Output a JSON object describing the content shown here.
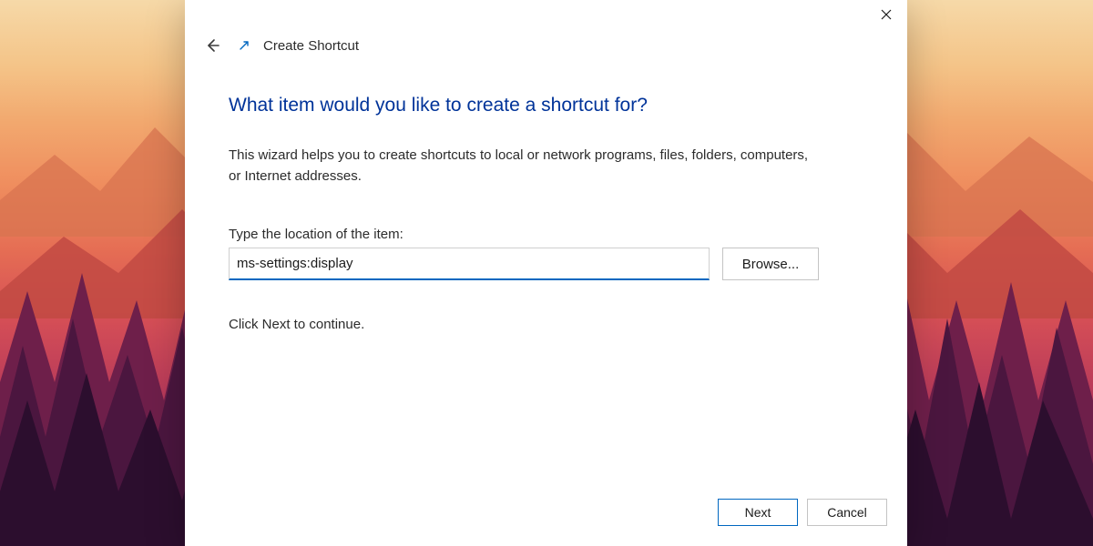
{
  "header": {
    "title": "Create Shortcut"
  },
  "main": {
    "heading": "What item would you like to create a shortcut for?",
    "description": "This wizard helps you to create shortcuts to local or network programs, files, folders, computers, or Internet addresses.",
    "field_label": "Type the location of the item:",
    "location_value": "ms-settings:display",
    "browse_label": "Browse...",
    "hint": "Click Next to continue."
  },
  "footer": {
    "next_label": "Next",
    "cancel_label": "Cancel"
  },
  "colors": {
    "accent": "#0067c0",
    "heading": "#003399"
  }
}
